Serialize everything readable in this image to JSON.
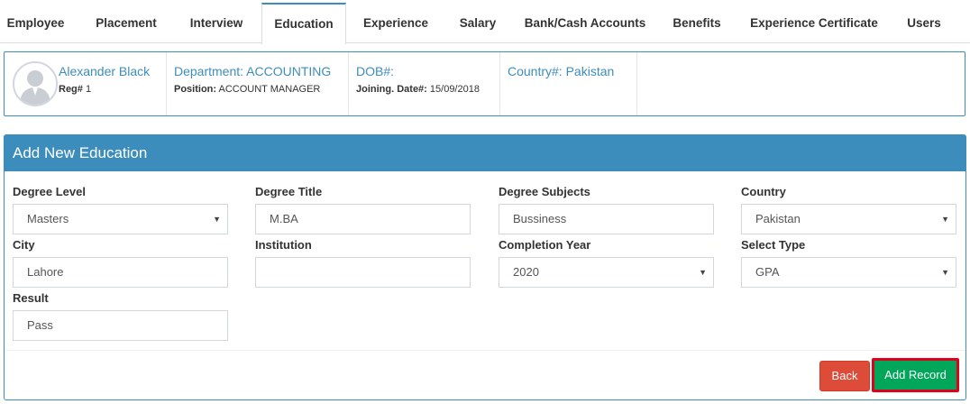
{
  "tabs": [
    {
      "label": "Employee",
      "active": false
    },
    {
      "label": "Placement",
      "active": false
    },
    {
      "label": "Interview",
      "active": false
    },
    {
      "label": "Education",
      "active": true
    },
    {
      "label": "Experience",
      "active": false
    },
    {
      "label": "Salary",
      "active": false
    },
    {
      "label": "Bank/Cash Accounts",
      "active": false
    },
    {
      "label": "Benefits",
      "active": false
    },
    {
      "label": "Experience Certificate",
      "active": false
    },
    {
      "label": "Users",
      "active": false
    }
  ],
  "profile": {
    "name": "Alexander Black",
    "reg_label": "Reg#",
    "reg_value": "1",
    "department": "Department: ACCOUNTING",
    "position_label": "Position:",
    "position_value": "ACCOUNT MANAGER",
    "dob": "DOB#:",
    "joining_label": "Joining. Date#:",
    "joining_value": "15/09/2018",
    "country": "Country#: Pakistan"
  },
  "panel": {
    "title": "Add New Education"
  },
  "form": {
    "degree_level": {
      "label": "Degree Level",
      "value": "Masters"
    },
    "degree_title": {
      "label": "Degree Title",
      "value": "M.BA"
    },
    "degree_subjects": {
      "label": "Degree Subjects",
      "value": "Bussiness"
    },
    "country": {
      "label": "Country",
      "value": "Pakistan"
    },
    "city": {
      "label": "City",
      "value": "Lahore"
    },
    "institution": {
      "label": "Institution",
      "value": ""
    },
    "completion_year": {
      "label": "Completion Year",
      "value": "2020"
    },
    "select_type": {
      "label": "Select Type",
      "value": "GPA"
    },
    "result": {
      "label": "Result",
      "value": "Pass"
    }
  },
  "buttons": {
    "back": "Back",
    "add_record": "Add Record"
  },
  "colors": {
    "primary": "#3c8dbc",
    "danger": "#dd4b39",
    "success": "#00a65a",
    "highlight": "#e0001b"
  },
  "icons": {
    "avatar": "user-avatar-icon",
    "select_caret": "caret-down-icon"
  }
}
